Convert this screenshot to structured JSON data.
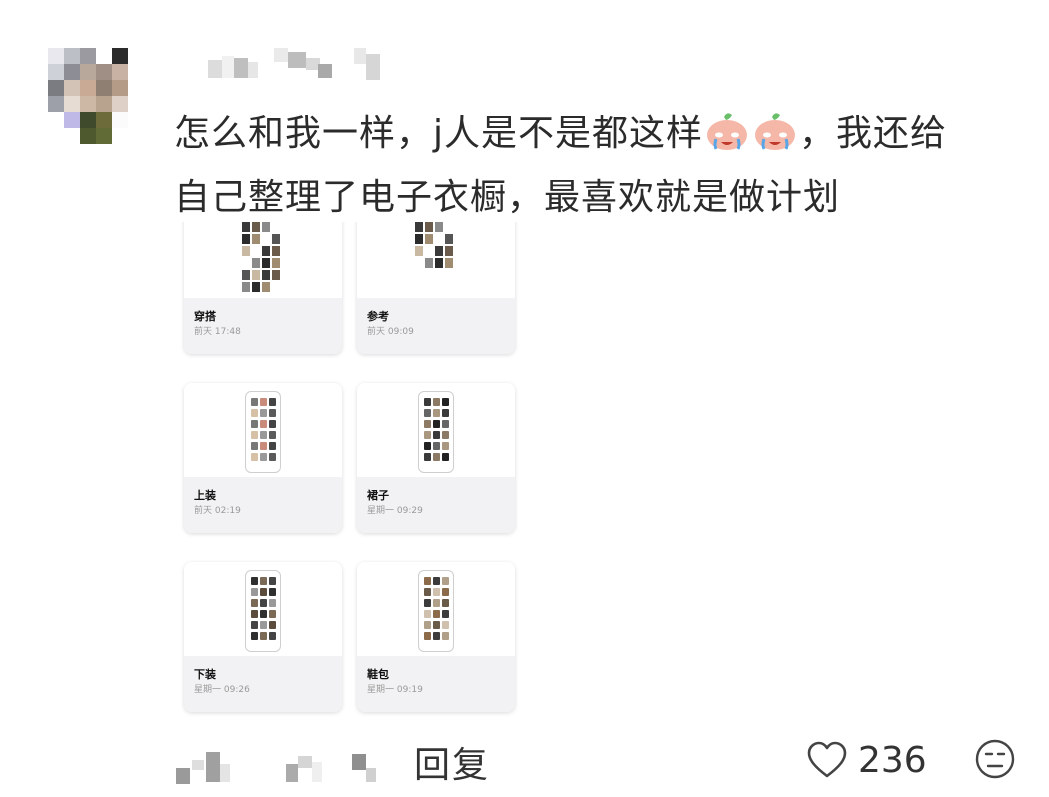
{
  "comment": {
    "line1_before_emoji": "怎么和我一样，j人是不是都这样",
    "line1_after_emoji": "，我还给",
    "line2": "自己整理了电子衣橱，最喜欢就是做计划",
    "emoji_name": "crying-peach-emoji"
  },
  "attachment": {
    "cards": [
      {
        "title": "穿搭",
        "time": "前天 17:48"
      },
      {
        "title": "参考",
        "time": "前天 09:09"
      },
      {
        "title": "上装",
        "time": "前天 02:19"
      },
      {
        "title": "裙子",
        "time": "星期一 09:29"
      },
      {
        "title": "下装",
        "time": "星期一 09:26"
      },
      {
        "title": "鞋包",
        "time": "星期一 09:19"
      }
    ]
  },
  "actions": {
    "reply_label": "回复",
    "like_icon": "heart-icon",
    "like_count": "236",
    "face_icon": "expressionless-face-icon"
  }
}
